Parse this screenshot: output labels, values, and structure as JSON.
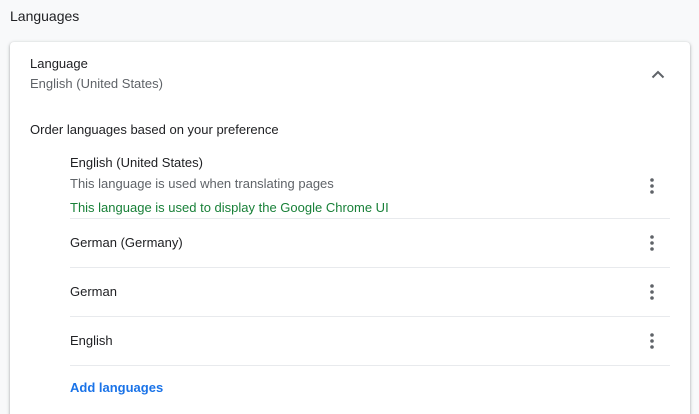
{
  "section": {
    "title": "Languages"
  },
  "language_header": {
    "title": "Language",
    "value": "English (United States)",
    "collapse_icon": "chevron-up-icon"
  },
  "order_label": "Order languages based on your preference",
  "languages": [
    {
      "name": "English (United States)",
      "translate_note": "This language is used when translating pages",
      "ui_note": "This language is used to display the Google Chrome UI",
      "menu_icon": "more-vert-icon"
    },
    {
      "name": "German (Germany)",
      "menu_icon": "more-vert-icon"
    },
    {
      "name": "German",
      "menu_icon": "more-vert-icon"
    },
    {
      "name": "English",
      "menu_icon": "more-vert-icon"
    }
  ],
  "add_languages_label": "Add languages",
  "colors": {
    "background": "#f8f9fa",
    "card": "#ffffff",
    "primary_text": "#202124",
    "secondary_text": "#5f6368",
    "ui_language_note": "#188038",
    "link": "#1a73e8",
    "divider": "#e8eaed"
  }
}
